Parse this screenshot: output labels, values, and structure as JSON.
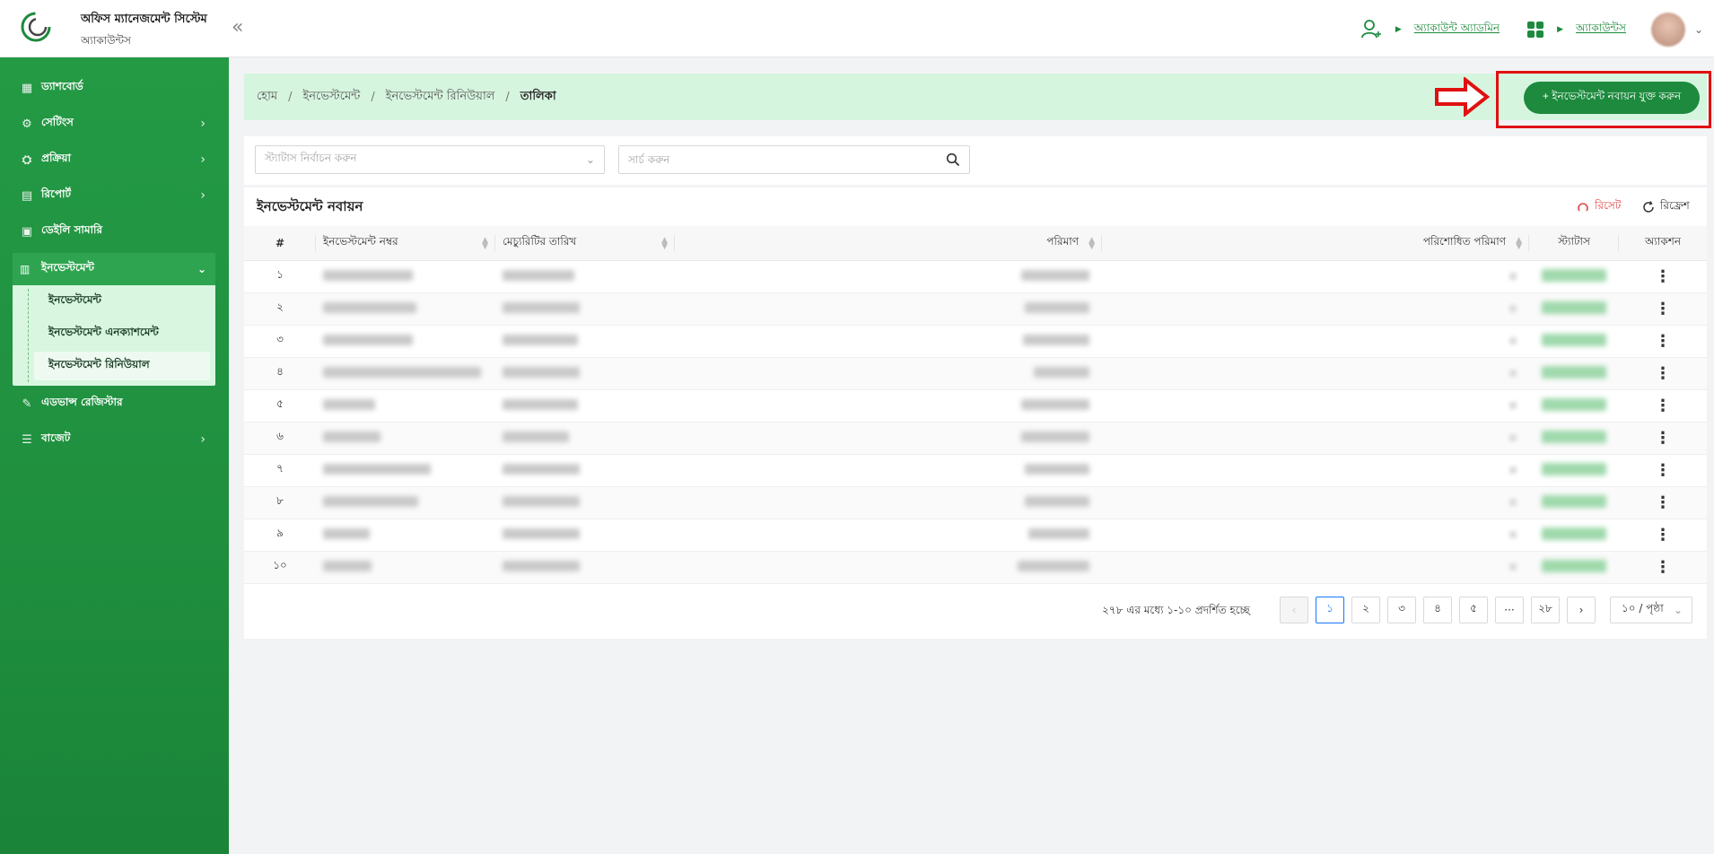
{
  "header": {
    "title": "অফিস ম্যানেজমেন্ট সিস্টেম",
    "subtitle": "অ্যাকাউন্টস",
    "role_link": "অ্যাকাউন্ট অ্যাডমিন",
    "module_link": "অ্যাকাউন্টস"
  },
  "sidebar": {
    "items": [
      {
        "label": "ড্যাশবোর্ড"
      },
      {
        "label": "সেটিংস"
      },
      {
        "label": "প্রক্রিয়া"
      },
      {
        "label": "রিপোর্ট"
      },
      {
        "label": "ডেইলি সামারি"
      },
      {
        "label": "ইনভেস্টমেন্ট"
      },
      {
        "label": "এডভান্স রেজিস্টার"
      },
      {
        "label": "বাজেট"
      }
    ],
    "submenu": [
      {
        "label": "ইনভেস্টমেন্ট"
      },
      {
        "label": "ইনভেস্টমেন্ট এনক্যাশমেন্ট"
      },
      {
        "label": "ইনভেস্টমেন্ট রিনিউয়াল"
      }
    ]
  },
  "breadcrumb": {
    "home": "হোম",
    "investment": "ইনভেস্টমেন্ট",
    "renewal": "ইনভেস্টমেন্ট রিনিউয়াল",
    "current": "তালিকা"
  },
  "add_button": "+ ইনভেস্টমেন্ট নবায়ন যুক্ত করুন",
  "filters": {
    "status_placeholder": "স্ট্যাটাস নির্বাচন করুন",
    "search_placeholder": "সার্চ করুন"
  },
  "table": {
    "title": "ইনভেস্টমেন্ট নবায়ন",
    "reset_label": "রিসেট",
    "refresh_label": "রিফ্রেশ",
    "columns": {
      "index": "#",
      "number": "ইনভেস্টমেন্ট নম্বর",
      "maturity": "মেচ্যুরিটির তারিখ",
      "amount": "পরিমাণ",
      "paid": "পরিশোধিত পরিমাণ",
      "status": "স্ট্যাটাস",
      "action": "অ্যাকশন"
    },
    "rows": [
      "১",
      "২",
      "৩",
      "৪",
      "৫",
      "৬",
      "৭",
      "৮",
      "৯",
      "১০"
    ]
  },
  "pagination": {
    "info": "২৭৮ এর মধ্যে ১-১০ প্রদর্শিত হচ্ছে",
    "pages": [
      "১",
      "২",
      "৩",
      "৪",
      "৫",
      "···",
      "২৮"
    ],
    "page_size": "১০ / পৃষ্ঠা"
  },
  "colors": {
    "primary": "#1d8a3e",
    "sidebar": "#249a45",
    "breadcrumb_bg": "#d6f5df",
    "highlight": "#e01010"
  }
}
